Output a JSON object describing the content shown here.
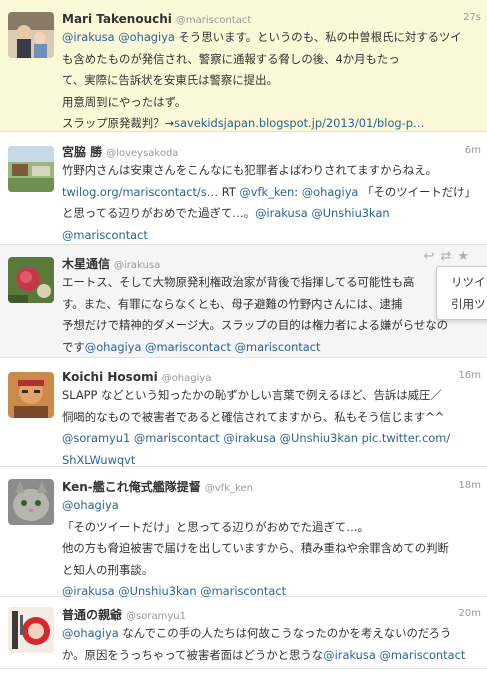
{
  "tweets": [
    {
      "name": "Mari Takenouchi",
      "screen_name": "@mariscontact",
      "time": "27s",
      "lines": [
        [
          {
            "t": "@irakusa",
            "link": true
          },
          {
            "t": " "
          },
          {
            "t": "@ohagiya",
            "link": true
          },
          {
            "t": " そう思います。というのも、私の中曽根氏に対するツイ"
          }
        ],
        [
          {
            "t": "も含めたものが発信され、警察に通報する脅しの後、4か月もたっ"
          }
        ],
        [
          {
            "t": "て、実際に告訴状を安東氏は警察に提出。"
          }
        ],
        [
          {
            "t": "用意周到にやったはず。"
          }
        ],
        [
          {
            "t": "スラップ原発裁判？→"
          },
          {
            "t": "savekidsjapan.blogspot.jp/2013/01/blog-p…",
            "link": true
          }
        ]
      ]
    },
    {
      "name": "宮脇 勝",
      "screen_name": "@loveysakoda",
      "time": "6m",
      "lines": [
        [
          {
            "t": "竹野内さんは安東さんをこんなにも犯罪者よばわりされてますからねえ。"
          }
        ],
        [
          {
            "t": "twilog.org/mariscontact/s…",
            "link": true
          },
          {
            "t": " RT "
          },
          {
            "t": "@vfk_ken",
            "link": true
          },
          {
            "t": ": "
          },
          {
            "t": "@ohagiya",
            "link": true
          },
          {
            "t": " 「そのツイートだけ」"
          }
        ],
        [
          {
            "t": "と思ってる辺りがおめでた過ぎて…。"
          },
          {
            "t": "@irakusa",
            "link": true
          },
          {
            "t": " "
          },
          {
            "t": "@Unshiu3kan",
            "link": true
          }
        ],
        [
          {
            "t": "@mariscontact",
            "link": true
          }
        ]
      ]
    },
    {
      "name": "木星通信",
      "screen_name": "@irakusa",
      "time": "",
      "lines": [
        [
          {
            "t": "エートス、そして大物原発利権政治家が背後で指揮してる可能性も高"
          }
        ],
        [
          {
            "t": "す。また、有罪にならなくとも、母子避難の竹野内さんには、逮捕"
          }
        ],
        [
          {
            "t": "予想だけで精神的ダメージ大。スラップの目的は権力者による嫌がらせなの"
          }
        ],
        [
          {
            "t": "です"
          },
          {
            "t": "@ohagiya",
            "link": true
          },
          {
            "t": " "
          },
          {
            "t": "@mariscontact",
            "link": true
          },
          {
            "t": " "
          },
          {
            "t": "@mariscontact",
            "link": true
          }
        ]
      ]
    },
    {
      "name": "Koichi Hosomi",
      "screen_name": "@ohagiya",
      "time": "16m",
      "lines": [
        [
          {
            "t": "SLAPP などという知ったかの恥ずかしい言葉で例えるほど、告訴は威圧／"
          }
        ],
        [
          {
            "t": "恫喝的なもので被害者であると確信されてますから、私もそう信じます^^"
          }
        ],
        [
          {
            "t": "      "
          },
          {
            "t": "@soramyu1",
            "link": true
          },
          {
            "t": " "
          },
          {
            "t": "@mariscontact",
            "link": true
          },
          {
            "t": " "
          },
          {
            "t": "@irakusa",
            "link": true
          },
          {
            "t": " "
          },
          {
            "t": "@Unshiu3kan",
            "link": true
          },
          {
            "t": " "
          },
          {
            "t": "pic.twitter.com/",
            "link": true
          }
        ],
        [
          {
            "t": "ShXLWuwqvt",
            "link": true
          }
        ]
      ]
    },
    {
      "name": "Ken-艦これ俺式艦隊提督",
      "screen_name": "@vfk_ken",
      "time": "18m",
      "lines": [
        [
          {
            "t": "@ohagiya",
            "link": true
          }
        ],
        [
          {
            "t": "「そのツイートだけ」と思ってる辺りがおめでた過ぎて…。"
          }
        ],
        [
          {
            "t": "他の方も脅迫被害で届けを出していますから、積み重ねや余罪含めての判断"
          }
        ],
        [
          {
            "t": "と知人の刑事談。"
          }
        ],
        [
          {
            "t": "@irakusa",
            "link": true
          },
          {
            "t": " "
          },
          {
            "t": "@Unshiu3kan",
            "link": true
          },
          {
            "t": " "
          },
          {
            "t": "@mariscontact",
            "link": true
          }
        ]
      ]
    },
    {
      "name": "普通の親爺",
      "screen_name": "@soramyu1",
      "time": "20m",
      "lines": [
        [
          {
            "t": "@ohagiya",
            "link": true
          },
          {
            "t": " なんでこの手の人たちは何故こうなったのかを考えないのだろう"
          }
        ],
        [
          {
            "t": "か。原因をうっちゃって被害者面はどうかと思うな"
          },
          {
            "t": "@irakusa",
            "link": true
          },
          {
            "t": " "
          },
          {
            "t": "@mariscontact",
            "link": true
          }
        ]
      ]
    }
  ],
  "tooltip": {
    "options": [
      "リツイ",
      "引用ツ"
    ]
  },
  "colors": {
    "highlight": "#fbf8d8",
    "link": "#2a6496"
  }
}
